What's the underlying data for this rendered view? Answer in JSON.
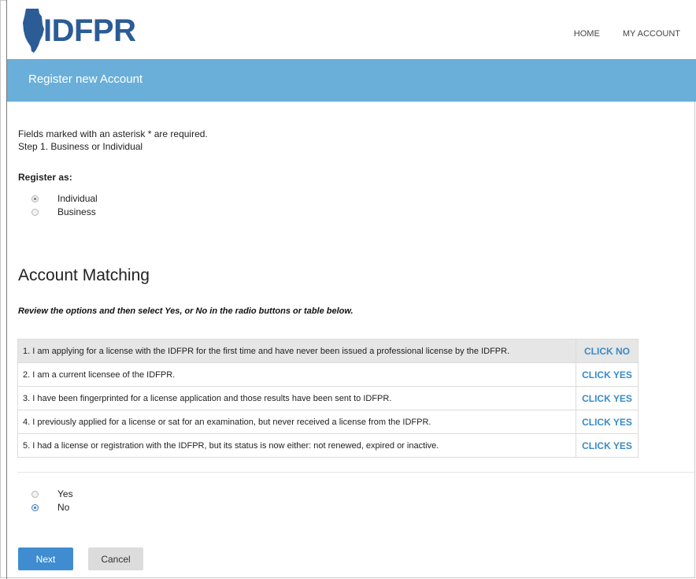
{
  "brand": {
    "name": "IDFPR"
  },
  "nav": {
    "home": "HOME",
    "my_account": "MY ACCOUNT"
  },
  "banner": {
    "title": "Register new Account"
  },
  "intro": {
    "required_note": "Fields marked with an asterisk * are required.",
    "step": "Step 1. Business or Individual"
  },
  "register_as": {
    "label": "Register as:",
    "options": [
      {
        "label": "Individual",
        "checked": true
      },
      {
        "label": "Business",
        "checked": false
      }
    ]
  },
  "matching": {
    "heading": "Account Matching",
    "instructions": "Review the options and then select Yes, or No in the radio buttons or table below.",
    "rows": [
      {
        "text": "1. I am applying for a license with the IDFPR for the first time and have never been issued a professional license by the IDFPR.",
        "action": "CLICK NO",
        "highlighted": true
      },
      {
        "text": "2. I am a current licensee of the IDFPR.",
        "action": "CLICK YES",
        "highlighted": false
      },
      {
        "text": "3. I have been fingerprinted for a license application and those results have been sent to IDFPR.",
        "action": "CLICK YES",
        "highlighted": false
      },
      {
        "text": "4. I previously applied for a license or sat for an examination, but never received a license from the IDFPR.",
        "action": "CLICK YES",
        "highlighted": false
      },
      {
        "text": "5. I had a license or registration with the IDFPR, but its status is now either: not renewed, expired or inactive.",
        "action": "CLICK YES",
        "highlighted": false
      }
    ],
    "answer_options": [
      {
        "label": "Yes",
        "checked": false
      },
      {
        "label": "No",
        "checked": true
      }
    ]
  },
  "buttons": {
    "next": "Next",
    "cancel": "Cancel"
  },
  "colors": {
    "banner": "#6aafd9",
    "brand": "#2b5c96",
    "link": "#3a8ac6",
    "primary_button": "#3f8dd0"
  }
}
